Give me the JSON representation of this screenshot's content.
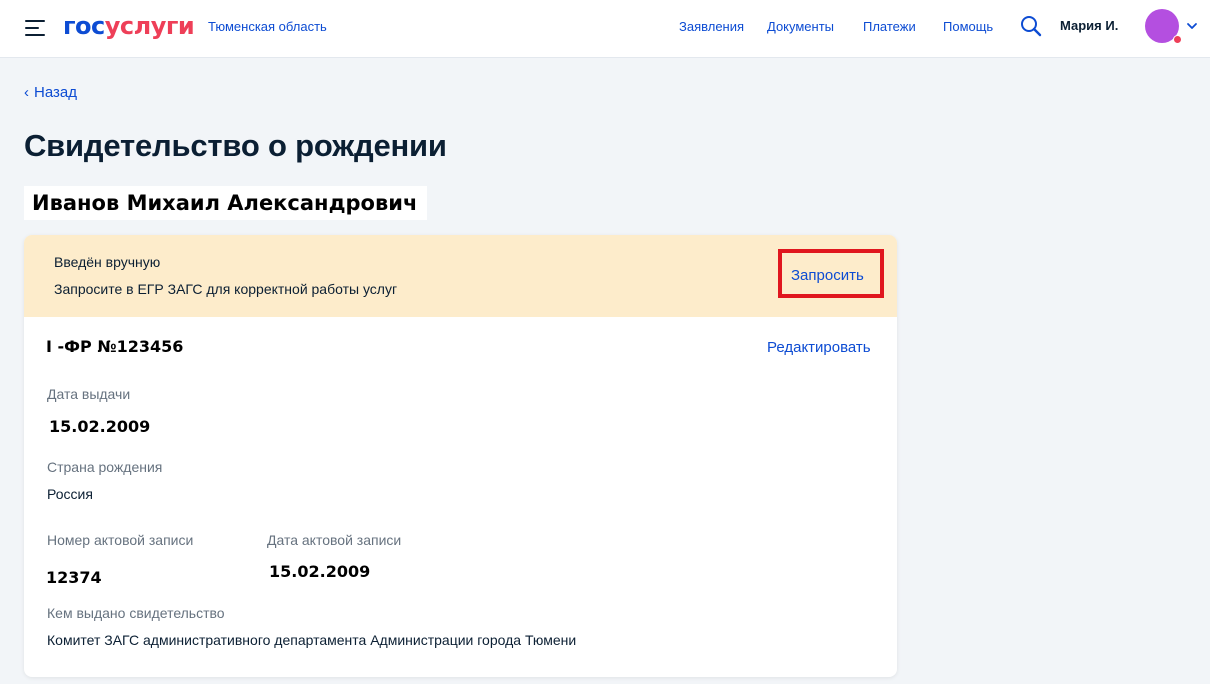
{
  "header": {
    "logo_part1": "гос",
    "logo_part2": "услуги",
    "region": "Тюменская область",
    "nav": [
      {
        "label": "Заявления"
      },
      {
        "label": "Документы"
      },
      {
        "label": "Платежи"
      },
      {
        "label": "Помощь"
      }
    ],
    "user_name": "Мария И.",
    "icons": {
      "menu": "burger-menu-icon",
      "search": "search-icon",
      "chevron": "chevron-down-icon"
    },
    "colors": {
      "brand_blue": "#0d4cd3",
      "brand_red": "#ee3f58",
      "avatar": "#b44fe0"
    }
  },
  "back": {
    "arrow": "‹",
    "label": "Назад"
  },
  "page": {
    "title": "Свидетельство о рождении",
    "person_name": "Иванов Михаил Александрович"
  },
  "banner": {
    "title": "Введён вручную",
    "text": "Запросите в ЕГР ЗАГС для корректной работы услуг",
    "request_label": "Запросить",
    "background": "#fdeccb",
    "highlight_color": "#e0161e"
  },
  "document": {
    "number_prefix": "I -ФР №",
    "number": "123456",
    "edit_label": "Редактировать",
    "fields": {
      "issue_date": {
        "label": "Дата выдачи",
        "value": "15.02.2009"
      },
      "birth_country": {
        "label": "Страна рождения",
        "value": "Россия"
      },
      "record_number": {
        "label": "Номер актовой записи",
        "value": "12374"
      },
      "record_date": {
        "label": "Дата актовой записи",
        "value": "15.02.2009"
      },
      "issued_by": {
        "label": "Кем выдано свидетельство",
        "value": "Комитет ЗАГС административного департамента Администрации города Тюмени"
      }
    }
  }
}
